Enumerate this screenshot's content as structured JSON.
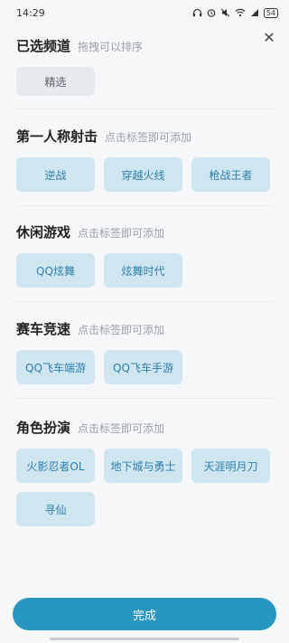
{
  "status_bar": {
    "time": "14:29",
    "battery": "54"
  },
  "sections": [
    {
      "title": "已选频道",
      "hint": "拖拽可以排序",
      "tags": [
        "精选"
      ]
    },
    {
      "title": "第一人称射击",
      "hint": "点击标签即可添加",
      "tags": [
        "逆战",
        "穿越火线",
        "枪战王者"
      ]
    },
    {
      "title": "休闲游戏",
      "hint": "点击标签即可添加",
      "tags": [
        "QQ炫舞",
        "炫舞时代"
      ]
    },
    {
      "title": "赛车竞速",
      "hint": "点击标签即可添加",
      "tags": [
        "QQ飞车端游",
        "QQ飞车手游"
      ]
    },
    {
      "title": "角色扮演",
      "hint": "点击标签即可添加",
      "tags": [
        "火影忍者OL",
        "地下城与勇士",
        "天涯明月刀",
        "寻仙"
      ]
    }
  ],
  "done_label": "完成",
  "colors": {
    "accent": "#2797c1",
    "tag_bg": "#cfe6f1",
    "tag_text": "#2d7fab",
    "selected_tag_bg": "#e6e9ed"
  },
  "icons": {
    "close": "close-icon",
    "headphones": "headphones-icon",
    "alarm": "alarm-icon",
    "mute": "mute-icon",
    "wifi": "wifi-icon",
    "signal": "signal-icon",
    "battery": "battery-icon"
  }
}
